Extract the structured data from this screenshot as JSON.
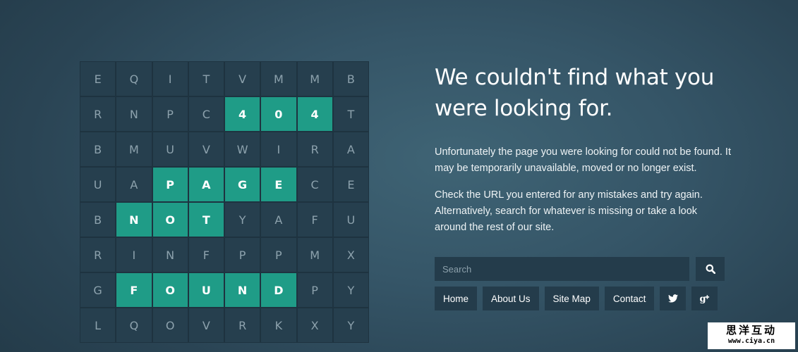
{
  "puzzle": {
    "rows": [
      [
        {
          "l": "E",
          "h": false
        },
        {
          "l": "Q",
          "h": false
        },
        {
          "l": "I",
          "h": false
        },
        {
          "l": "T",
          "h": false
        },
        {
          "l": "V",
          "h": false
        },
        {
          "l": "M",
          "h": false
        },
        {
          "l": "M",
          "h": false
        },
        {
          "l": "B",
          "h": false
        }
      ],
      [
        {
          "l": "R",
          "h": false
        },
        {
          "l": "N",
          "h": false
        },
        {
          "l": "P",
          "h": false
        },
        {
          "l": "C",
          "h": false
        },
        {
          "l": "4",
          "h": true
        },
        {
          "l": "0",
          "h": true
        },
        {
          "l": "4",
          "h": true
        },
        {
          "l": "T",
          "h": false
        }
      ],
      [
        {
          "l": "B",
          "h": false
        },
        {
          "l": "M",
          "h": false
        },
        {
          "l": "U",
          "h": false
        },
        {
          "l": "V",
          "h": false
        },
        {
          "l": "W",
          "h": false
        },
        {
          "l": "I",
          "h": false
        },
        {
          "l": "R",
          "h": false
        },
        {
          "l": "A",
          "h": false
        }
      ],
      [
        {
          "l": "U",
          "h": false
        },
        {
          "l": "A",
          "h": false
        },
        {
          "l": "P",
          "h": true
        },
        {
          "l": "A",
          "h": true
        },
        {
          "l": "G",
          "h": true
        },
        {
          "l": "E",
          "h": true
        },
        {
          "l": "C",
          "h": false
        },
        {
          "l": "E",
          "h": false
        }
      ],
      [
        {
          "l": "B",
          "h": false
        },
        {
          "l": "N",
          "h": true
        },
        {
          "l": "O",
          "h": true
        },
        {
          "l": "T",
          "h": true
        },
        {
          "l": "Y",
          "h": false
        },
        {
          "l": "A",
          "h": false
        },
        {
          "l": "F",
          "h": false
        },
        {
          "l": "U",
          "h": false
        }
      ],
      [
        {
          "l": "R",
          "h": false
        },
        {
          "l": "I",
          "h": false
        },
        {
          "l": "N",
          "h": false
        },
        {
          "l": "F",
          "h": false
        },
        {
          "l": "P",
          "h": false
        },
        {
          "l": "P",
          "h": false
        },
        {
          "l": "M",
          "h": false
        },
        {
          "l": "X",
          "h": false
        }
      ],
      [
        {
          "l": "G",
          "h": false
        },
        {
          "l": "F",
          "h": true
        },
        {
          "l": "O",
          "h": true
        },
        {
          "l": "U",
          "h": true
        },
        {
          "l": "N",
          "h": true
        },
        {
          "l": "D",
          "h": true
        },
        {
          "l": "P",
          "h": false
        },
        {
          "l": "Y",
          "h": false
        }
      ],
      [
        {
          "l": "L",
          "h": false
        },
        {
          "l": "Q",
          "h": false
        },
        {
          "l": "O",
          "h": false
        },
        {
          "l": "V",
          "h": false
        },
        {
          "l": "R",
          "h": false
        },
        {
          "l": "K",
          "h": false
        },
        {
          "l": "X",
          "h": false
        },
        {
          "l": "Y",
          "h": false
        }
      ]
    ]
  },
  "content": {
    "heading": "We couldn't find what you were looking for.",
    "paragraph1": "Unfortunately the page you were looking for could not be found. It may be temporarily unavailable, moved or no longer exist.",
    "paragraph2": "Check the URL you entered for any mistakes and try again. Alternatively, search for whatever is missing or take a look around the rest of our site."
  },
  "search": {
    "placeholder": "Search",
    "value": "",
    "button_icon": "search-icon"
  },
  "nav": {
    "home": "Home",
    "about": "About Us",
    "sitemap": "Site Map",
    "contact": "Contact",
    "twitter_icon": "twitter-icon",
    "googleplus_icon": "google-plus-icon"
  },
  "watermark": {
    "top": "思洋互动",
    "bottom": "www.ciya.cn"
  },
  "colors": {
    "highlight": "#1f9c87",
    "cell": "#263f4e",
    "button": "#243c4b"
  }
}
